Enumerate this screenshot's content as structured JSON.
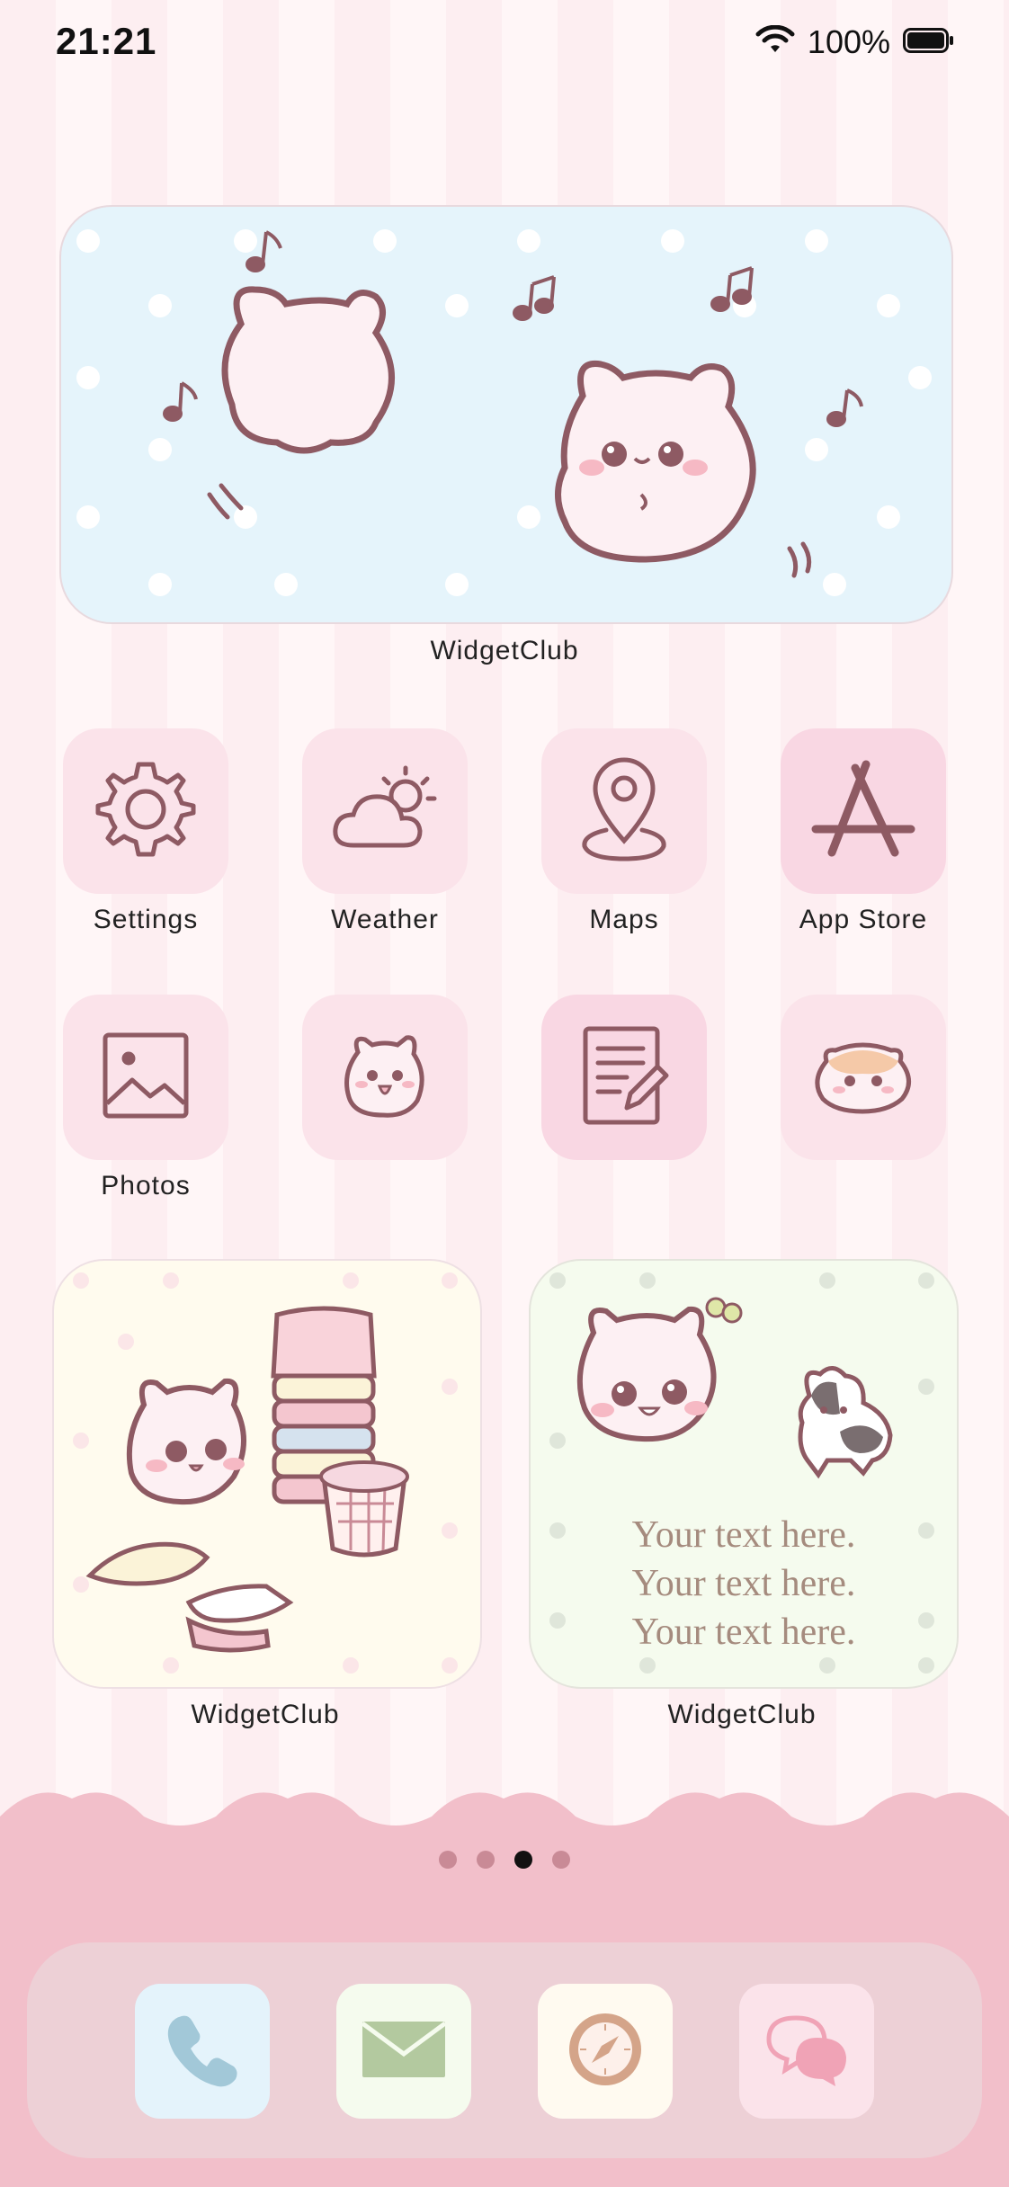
{
  "status_bar": {
    "time": "21:21",
    "battery_text": "100%"
  },
  "widgets": {
    "top": {
      "label": "WidgetClub"
    },
    "bottom_left": {
      "label": "WidgetClub"
    },
    "bottom_right": {
      "label": "WidgetClub",
      "text_lines": [
        "Your text here.",
        "Your text here.",
        "Your text here."
      ]
    }
  },
  "apps": [
    {
      "label": "Settings",
      "icon": "gear-icon"
    },
    {
      "label": "Weather",
      "icon": "cloud-sun-icon"
    },
    {
      "label": "Maps",
      "icon": "map-pin-icon"
    },
    {
      "label": "App Store",
      "icon": "app-store-icon"
    },
    {
      "label": "Photos",
      "icon": "image-icon"
    },
    {
      "label": "",
      "icon": "cat-character-icon"
    },
    {
      "label": "",
      "icon": "notes-edit-icon"
    },
    {
      "label": "",
      "icon": "hamster-icon"
    }
  ],
  "page_indicator": {
    "count": 4,
    "active_index": 2
  },
  "dock": [
    {
      "name": "Phone",
      "icon": "phone-icon"
    },
    {
      "name": "Mail",
      "icon": "mail-icon"
    },
    {
      "name": "Safari",
      "icon": "compass-icon"
    },
    {
      "name": "Messages",
      "icon": "chat-bubbles-icon"
    }
  ],
  "colors": {
    "icon_stroke": "#8e5a63",
    "dock_pink": "#f2bfca"
  }
}
